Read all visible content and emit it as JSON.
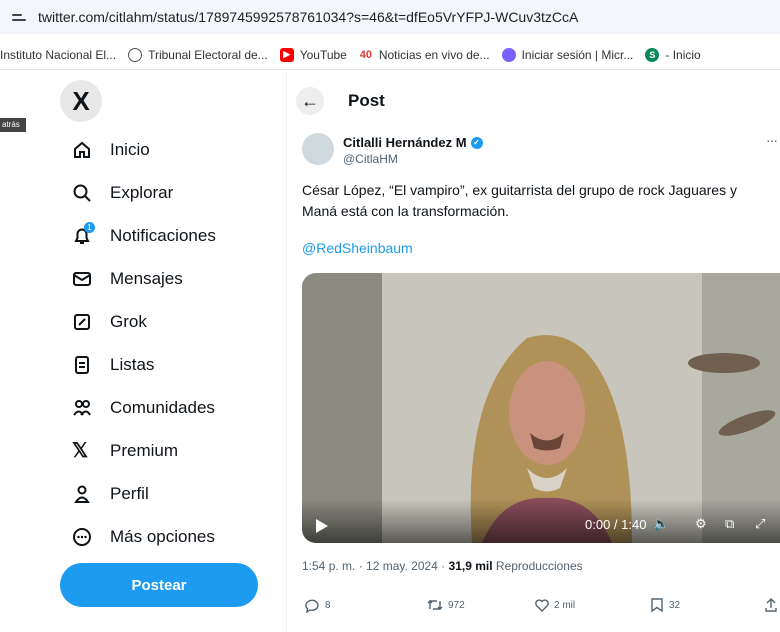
{
  "browser": {
    "url": "twitter.com/citlahm/status/1789745992578761034?s=46&t=dfEo5VrYFPJ-WCuv3tzCcA",
    "bookmarks": [
      {
        "label": "Instituto Nacional El...",
        "icon": "",
        "color": ""
      },
      {
        "label": "Tribunal Electoral de...",
        "icon": "globe-icon",
        "color": "#555555"
      },
      {
        "label": "YouTube",
        "icon": "youtube-icon",
        "color": "#ff0000"
      },
      {
        "label": "Noticias en vivo de...",
        "icon": "news-icon",
        "color": "#e53935"
      },
      {
        "label": "Iniciar sesión | Micr...",
        "icon": "microsoft-icon",
        "color": "#7b61ff"
      },
      {
        "label": "- Inicio",
        "icon": "sharepoint-icon",
        "color": "#0a8a5a"
      }
    ],
    "left_tag": "atrás"
  },
  "sidebar": {
    "logo": "X",
    "items": [
      {
        "label": "Inicio",
        "icon": "home-icon"
      },
      {
        "label": "Explorar",
        "icon": "search-icon"
      },
      {
        "label": "Notificaciones",
        "icon": "bell-icon",
        "badge": "1"
      },
      {
        "label": "Mensajes",
        "icon": "mail-icon"
      },
      {
        "label": "Grok",
        "icon": "grok-icon"
      },
      {
        "label": "Listas",
        "icon": "list-icon"
      },
      {
        "label": "Comunidades",
        "icon": "communities-icon"
      },
      {
        "label": "Premium",
        "icon": "x-premium-icon"
      },
      {
        "label": "Perfil",
        "icon": "person-icon"
      },
      {
        "label": "Más opciones",
        "icon": "more-circle-icon"
      }
    ],
    "post_button": "Postear"
  },
  "header": {
    "title": "Post"
  },
  "tweet": {
    "author_name": "Citlalli Hernández M",
    "handle": "@CitlaHM",
    "more": "···",
    "text": "César López, “El vampiro”, ex guitarrista del grupo de rock Jaguares y Maná está con la transformación.",
    "mention": "@RedSheinbaum",
    "video": {
      "time": "0:00 / 1:40",
      "progress": 0
    },
    "timestamp": "1:54 p. m. · 12 may. 2024 ·",
    "views_count": "31,9 mil",
    "views_label": "Reproducciones",
    "replies": "8",
    "reposts": "972",
    "likes": "2 mil",
    "bookmarks": "32"
  },
  "colors": {
    "accent": "#1d9bf0",
    "text": "#0f1419",
    "muted": "#536471"
  }
}
